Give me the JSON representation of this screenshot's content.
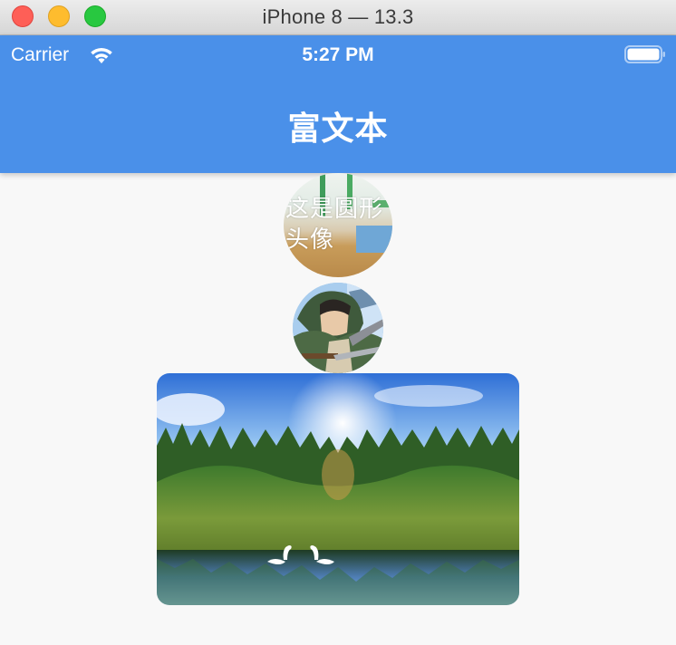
{
  "window": {
    "title": "iPhone 8 — 13.3",
    "controls": [
      "close-icon",
      "minimize-icon",
      "zoom-icon"
    ]
  },
  "status_bar": {
    "carrier": "Carrier",
    "time": "5:27 PM",
    "icons": [
      "wifi-icon",
      "battery-icon"
    ]
  },
  "nav": {
    "title": "富文本"
  },
  "avatar_text": {
    "caption": "这是圆形头像"
  },
  "colors": {
    "nav_background": "#4a90e9",
    "page_background": "#f8f8f8",
    "text_on_nav": "#ffffff"
  }
}
